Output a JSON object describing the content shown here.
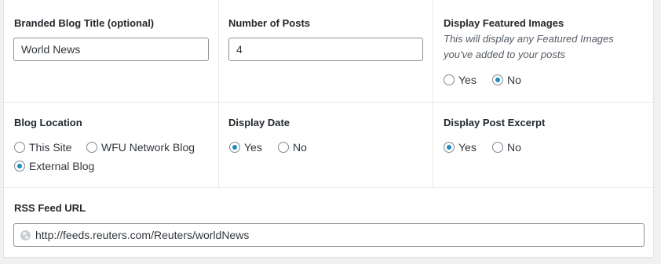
{
  "branded_title": {
    "label": "Branded Blog Title (optional)",
    "value": "World News"
  },
  "number_of_posts": {
    "label": "Number of Posts",
    "value": "4"
  },
  "featured_images": {
    "label": "Display Featured Images",
    "description_line1": "This will display any Featured Images",
    "description_line2": "you've added to your posts",
    "options": [
      {
        "label": "Yes",
        "selected": false
      },
      {
        "label": "No",
        "selected": true
      }
    ]
  },
  "blog_location": {
    "label": "Blog Location",
    "options": [
      {
        "label": "This Site",
        "selected": false
      },
      {
        "label": "WFU Network Blog",
        "selected": false
      },
      {
        "label": "External Blog",
        "selected": true
      }
    ]
  },
  "display_date": {
    "label": "Display Date",
    "options": [
      {
        "label": "Yes",
        "selected": true
      },
      {
        "label": "No",
        "selected": false
      }
    ]
  },
  "post_excerpt": {
    "label": "Display Post Excerpt",
    "options": [
      {
        "label": "Yes",
        "selected": true
      },
      {
        "label": "No",
        "selected": false
      }
    ]
  },
  "rss_feed": {
    "label": "RSS Feed URL",
    "value": "http://feeds.reuters.com/Reuters/worldNews",
    "icon": "globe-icon"
  },
  "colors": {
    "accent": "#1e8cbe",
    "border": "#8c8f94"
  }
}
